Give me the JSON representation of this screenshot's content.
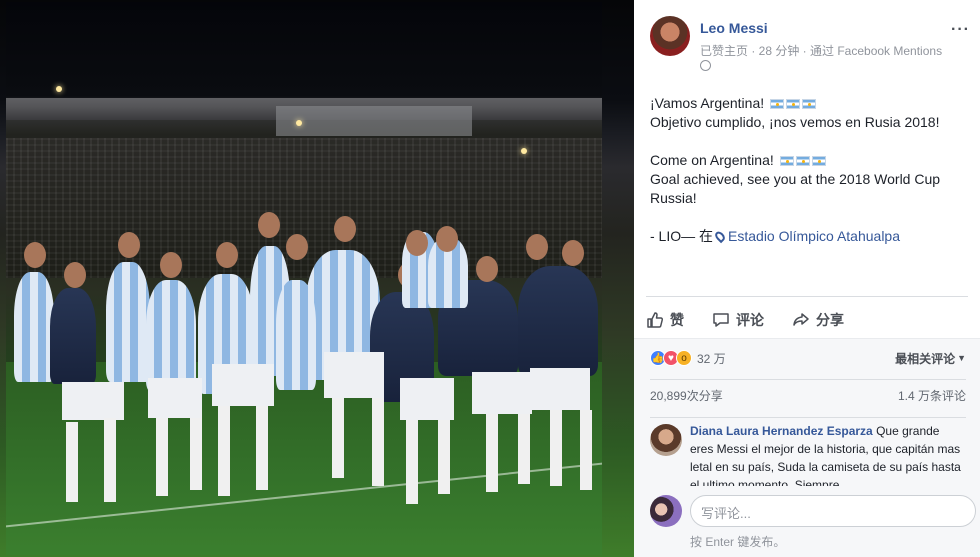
{
  "post": {
    "page_name": "Leo Messi",
    "meta": "已赞主页 · 28 分钟 · 通过 Facebook Mentions",
    "text": {
      "line1": "¡Vamos Argentina!",
      "line2": "Objetivo cumplido, ¡nos vemos en Rusia 2018!",
      "line3": "Come on Argentina!",
      "line4": "Goal achieved, see you at the 2018 World Cup Russia!",
      "signature": "- LIO— 在",
      "location": "Estadio Olímpico Atahualpa"
    },
    "flag_emoji_count": 3
  },
  "actions": {
    "like": "赞",
    "comment": "评论",
    "share": "分享"
  },
  "feedback": {
    "reaction_count": "32 万",
    "sort_label": "最相关评论",
    "shares": "20,899次分享",
    "comments_count": "1.4 万条评论"
  },
  "comment": {
    "author": "Diana Laura Hernandez Esparza",
    "text": "Que grande eres Messi el mejor de la historia, que capitán mas letal en su país, Suda la camiseta de su país hasta el ultimo momento, Siempre"
  },
  "composer": {
    "placeholder": "写评论...",
    "hint": "按 Enter 键发布。"
  },
  "colors": {
    "link_blue": "#365899",
    "meta_gray": "#90949c",
    "like_blue": "#4080ff",
    "love_red": "#f25268",
    "wow_yellow": "#f7b125"
  }
}
